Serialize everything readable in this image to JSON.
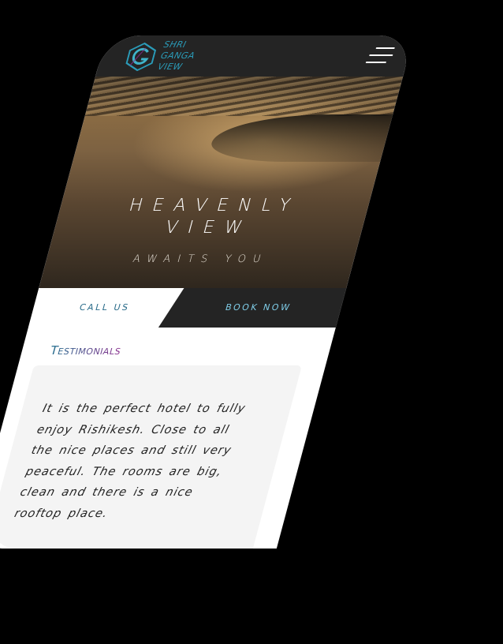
{
  "brand": {
    "logo_letter": "G",
    "name_lines": [
      "SHRI",
      "GANGA",
      "VIEW"
    ]
  },
  "nav": {
    "menu_icon": "hamburger-icon"
  },
  "hero": {
    "title_line1": "HEAVENLY",
    "title_line2": "VIEW",
    "subtitle": "AWAITS YOU"
  },
  "cta": {
    "call_label": "CALL US",
    "book_label": "BOOK NOW"
  },
  "testimonials": {
    "heading": "Testimonials",
    "quote": "It is the perfect hotel to fully enjoy Rishikesh. Close to all the nice places and still very peaceful. The rooms are big, clean and there is a nice rooftop place."
  },
  "colors": {
    "bar": "#242424",
    "accent": "#2a9bb8",
    "book_text": "#7ecbe6",
    "heading_gradient": [
      "#1f6c8c",
      "#8a2f8e"
    ]
  }
}
